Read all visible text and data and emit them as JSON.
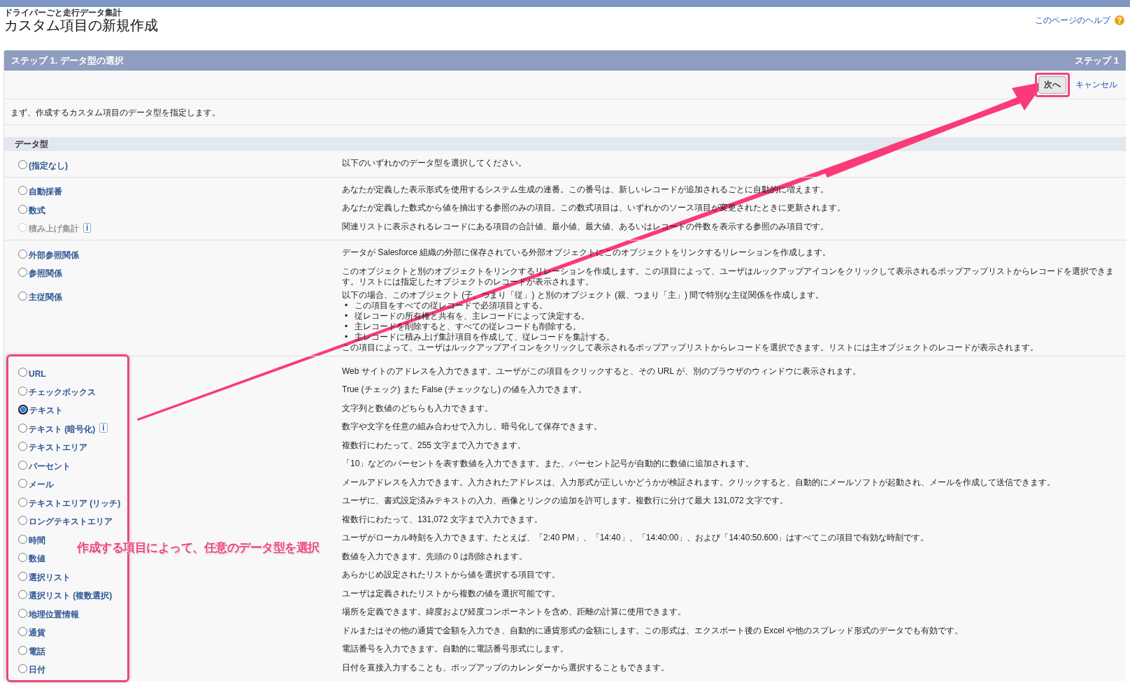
{
  "header": {
    "breadcrumb": "ドライバーごと走行データ集計",
    "title": "カスタム項目の新規作成",
    "help_link": "このページのヘルプ"
  },
  "panel": {
    "title": "ステップ 1. データ型の選択",
    "step": "ステップ 1",
    "buttons": [
      {
        "kind": "button",
        "label": "次へ",
        "highlighted": true
      },
      {
        "kind": "link",
        "label": "キャンセル",
        "highlighted": false
      }
    ],
    "intro": "まず、作成するカスタム項目のデータ型を指定します。",
    "section_title": "データ型"
  },
  "groups": [
    {
      "framed": false,
      "rows": [
        {
          "label": "(指定なし)",
          "selected": false,
          "disabled": false,
          "description": "以下のいずれかのデータ型を選択してください。"
        }
      ]
    },
    {
      "framed": false,
      "rows": [
        {
          "label": "自動採番",
          "selected": false,
          "disabled": false,
          "description": "あなたが定義した表示形式を使用するシステム生成の連番。この番号は、新しいレコードが追加されるごとに自動的に増えます。"
        },
        {
          "label": "数式",
          "selected": false,
          "disabled": false,
          "description": "あなたが定義した数式から値を抽出する参照のみの項目。この数式項目は、いずれかのソース項目が変更されたときに更新されます。"
        },
        {
          "label": "積み上げ集計",
          "selected": false,
          "disabled": true,
          "info": "i",
          "description": "関連リストに表示されるレコードにある項目の合計値、最小値、最大値、あるいはレコードの件数を表示する参照のみ項目です。"
        }
      ]
    },
    {
      "framed": false,
      "rows": [
        {
          "label": "外部参照関係",
          "selected": false,
          "disabled": false,
          "description": "データが Salesforce 組織の外部に保存されている外部オブジェクトにこのオブジェクトをリンクするリレーションを作成します。"
        },
        {
          "label": "参照関係",
          "selected": false,
          "disabled": false,
          "description": "このオブジェクトと別のオブジェクトをリンクするリレーションを作成します。この項目によって、ユーザはルックアップアイコンをクリックして表示されるポップアップリストからレコードを選択できます。リストには指定したオブジェクトのレコードが表示されます。"
        },
        {
          "label": "主従関係",
          "selected": false,
          "disabled": false,
          "bullet_marker": "•",
          "description": "以下の場合、このオブジェクト (子、つまり「従」) と別のオブジェクト (親、つまり「主」) 間で特別な主従関係を作成します。",
          "bullets": [
            "この項目をすべての従レコードで必須項目とする。",
            "従レコードの所有権と共有を、主レコードによって決定する。",
            "主レコードを削除すると、すべての従レコードも削除する。",
            "主レコードに積み上げ集計項目を作成して、従レコードを集計する。"
          ],
          "note": "この項目によって、ユーザはルックアップアイコンをクリックして表示されるポップアップリストからレコードを選択できます。リストには主オブジェクトのレコードが表示されます。"
        }
      ]
    },
    {
      "framed": true,
      "rows": [
        {
          "label": "URL",
          "selected": false,
          "disabled": false,
          "description": "Web サイトのアドレスを入力できます。ユーザがこの項目をクリックすると、その URL が、別のブラウザのウィンドウに表示されます。"
        },
        {
          "label": "チェックボックス",
          "selected": false,
          "disabled": false,
          "description": "True (チェック) また False (チェックなし) の値を入力できます。"
        },
        {
          "label": "テキスト",
          "selected": true,
          "disabled": false,
          "description": "文字列と数値のどちらも入力できます。"
        },
        {
          "label": "テキスト (暗号化)",
          "selected": false,
          "disabled": false,
          "info": "i",
          "description": "数字や文字を任意の組み合わせで入力し、暗号化して保存できます。"
        },
        {
          "label": "テキストエリア",
          "selected": false,
          "disabled": false,
          "description": "複数行にわたって、255 文字まで入力できます。"
        },
        {
          "label": "パーセント",
          "selected": false,
          "disabled": false,
          "description": "「10」などのパーセントを表す数値を入力できます。また、パーセント記号が自動的に数値に追加されます。"
        },
        {
          "label": "メール",
          "selected": false,
          "disabled": false,
          "description": "メールアドレスを入力できます。入力されたアドレスは、入力形式が正しいかどうかが検証されます。クリックすると、自動的にメールソフトが起動され、メールを作成して送信できます。"
        },
        {
          "label": "テキストエリア (リッチ)",
          "selected": false,
          "disabled": false,
          "description": "ユーザに、書式設定済みテキストの入力、画像とリンクの追加を許可します。複数行に分けて最大 131,072 文字です。"
        },
        {
          "label": "ロングテキストエリア",
          "selected": false,
          "disabled": false,
          "description": "複数行にわたって、131,072 文字まで入力できます。"
        },
        {
          "label": "時間",
          "selected": false,
          "disabled": false,
          "description": "ユーザがローカル時刻を入力できます。たとえば、「2:40 PM」、「14:40」、「14:40:00」、および「14:40:50.600」はすべてこの項目で有効な時刻です。"
        },
        {
          "label": "数値",
          "selected": false,
          "disabled": false,
          "description": "数値を入力できます。先頭の 0 は削除されます。"
        },
        {
          "label": "選択リスト",
          "selected": false,
          "disabled": false,
          "description": "あらかじめ設定されたリストから値を選択する項目です。"
        },
        {
          "label": "選択リスト (複数選択)",
          "selected": false,
          "disabled": false,
          "description": "ユーザは定義されたリストから複数の値を選択可能です。"
        },
        {
          "label": "地理位置情報",
          "selected": false,
          "disabled": false,
          "description": "場所を定義できます。緯度および経度コンポーネントを含め、距離の計算に使用できます。"
        },
        {
          "label": "通貨",
          "selected": false,
          "disabled": false,
          "description": "ドルまたはその他の通貨で金額を入力でき、自動的に通貨形式の金額にします。この形式は、エクスポート後の Excel や他のスプレッド形式のデータでも有効です。"
        },
        {
          "label": "電話",
          "selected": false,
          "disabled": false,
          "description": "電話番号を入力できます。自動的に電話番号形式にします。"
        },
        {
          "label": "日付",
          "selected": false,
          "disabled": false,
          "description": "日付を直接入力することも、ポップアップのカレンダーから選択することもできます。"
        }
      ]
    }
  ],
  "annotation": {
    "text": "作成する項目によって、任意のデータ型を選択"
  }
}
